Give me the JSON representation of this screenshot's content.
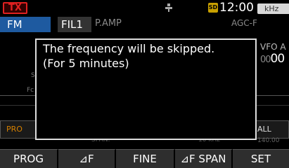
{
  "status": {
    "tx_label": "TX",
    "sd_label": "SD",
    "time": "12:00",
    "band_unit": "kHz"
  },
  "mode_row": {
    "mode": "FM",
    "filter": "FIL1",
    "preamp": "P.AMP",
    "agc": "AGC-F"
  },
  "background": {
    "vfo_label": "VFO A",
    "freq_fragment_dim": "00",
    "freq_fragment_bright": "00",
    "fragment_s": "S",
    "fragment_fc": "Fc",
    "prog_fragment": "PRO",
    "all_fragment": "ALL",
    "span_fragment": "SPAN:",
    "span_value": "10 kHz",
    "bottom_right_fragment": "140.00"
  },
  "dialog": {
    "line1": "The frequency will be skipped.",
    "line2": "(For 5 minutes)"
  },
  "function_bar": {
    "prog": "PROG",
    "delta_f": "⊿F",
    "fine": "FINE",
    "delta_f_span": "⊿F SPAN",
    "set": "SET"
  },
  "colors": {
    "tx_red": "#e02020",
    "mode_blue": "#1e5aa0",
    "prog_orange": "#d68000"
  }
}
